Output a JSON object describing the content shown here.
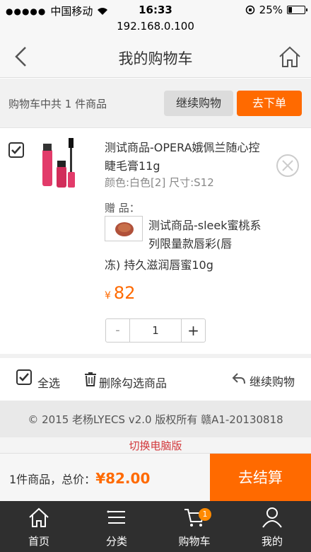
{
  "status_bar": {
    "carrier": "中国移动",
    "time": "16:33",
    "battery": "25%"
  },
  "url_bar": {
    "host": "192.168.0.100"
  },
  "header": {
    "title": "我的购物车"
  },
  "summary": {
    "text": "购物车中共 1 件商品",
    "continue_label": "继续购物",
    "order_label": "去下单"
  },
  "cart_item": {
    "title": "测试商品-OPERA娥佩兰随心控睫毛膏11g",
    "spec": "颜色:白色[2] 尺寸:S12",
    "gift_label": "赠 品：",
    "gift_title_a": "测试商品-sleek蜜桃系列限量款唇彩(唇",
    "gift_title_b": "冻) 持久滋润唇蜜10g",
    "currency": "¥",
    "price": "82",
    "quantity": "1",
    "minus": "-",
    "plus": "+"
  },
  "actions": {
    "select_all": "全选",
    "delete_selected": "删除勾选商品",
    "continue_shopping": "继续购物"
  },
  "footer": {
    "copyright": "© 2015 老杨LYECS v2.0 版权所有  赣A1-20130818",
    "switch_pc": "切换电脑版"
  },
  "checkout": {
    "total_prefix": "1件商品，总价：",
    "total_amount": "¥82.00",
    "checkout_label": "去结算"
  },
  "tabbar": {
    "tabs": [
      {
        "label": "首页",
        "icon": "home-icon"
      },
      {
        "label": "分类",
        "icon": "list-icon"
      },
      {
        "label": "购物车",
        "icon": "cart-icon"
      },
      {
        "label": "我的",
        "icon": "user-icon"
      }
    ],
    "cart_badge": "1"
  },
  "colors": {
    "accent": "#ff6a00",
    "tabbar_bg": "#2f2f2f",
    "link_red": "#d2383b"
  }
}
